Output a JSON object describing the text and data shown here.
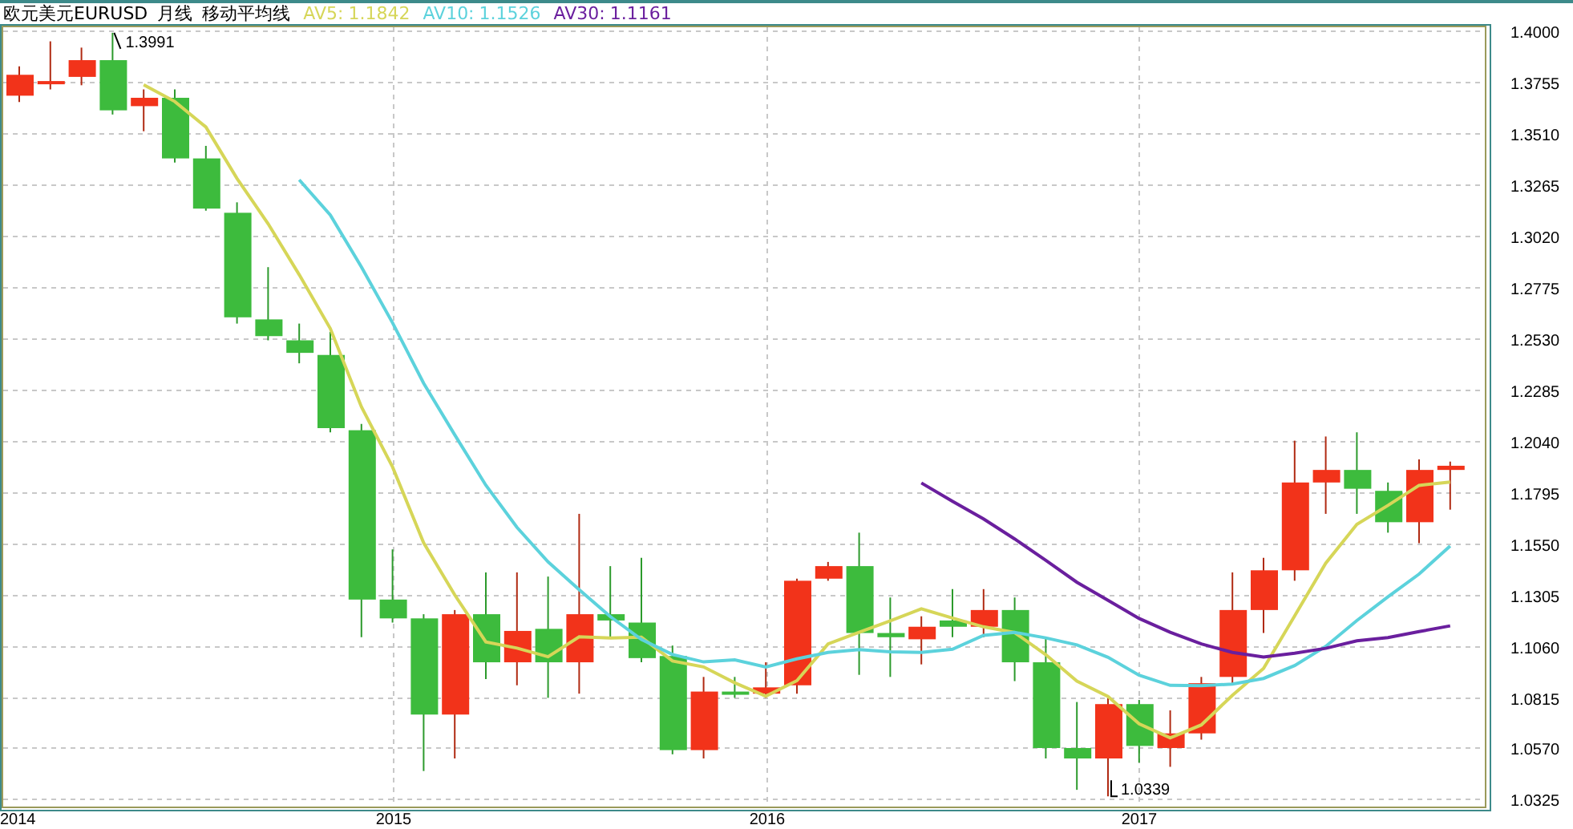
{
  "header": {
    "instrument": "欧元美元EURUSD",
    "period": "月线",
    "indicator": "移动平均线"
  },
  "chart": {
    "chart_data": {
      "type": "line",
      "grid": true,
      "categories": [
        "2014",
        null,
        null,
        null,
        null,
        null,
        null,
        null,
        null,
        null,
        null,
        null,
        "2015",
        null,
        null,
        null,
        null,
        null,
        null,
        null,
        null,
        null,
        null,
        null,
        "2016",
        null,
        null,
        null,
        null,
        null,
        null,
        null,
        null,
        null,
        null,
        null,
        "2017",
        null,
        null,
        null,
        null,
        null,
        null,
        null,
        null,
        null,
        null
      ],
      "ylim": [
        1.029,
        1.4025
      ],
      "yticks": [
        {
          "value": 1.4,
          "label": "1.4000"
        },
        {
          "value": 1.3755,
          "label": "1.3755"
        },
        {
          "value": 1.351,
          "label": "1.3510"
        },
        {
          "value": 1.3265,
          "label": "1.3265"
        },
        {
          "value": 1.302,
          "label": "1.3020"
        },
        {
          "value": 1.2775,
          "label": "1.2775"
        },
        {
          "value": 1.253,
          "label": "1.2530"
        },
        {
          "value": 1.2285,
          "label": "1.2285"
        },
        {
          "value": 1.204,
          "label": "1.2040"
        },
        {
          "value": 1.1795,
          "label": "1.1795"
        },
        {
          "value": 1.155,
          "label": "1.1550"
        },
        {
          "value": 1.1305,
          "label": "1.1305"
        },
        {
          "value": 1.106,
          "label": "1.1060"
        },
        {
          "value": 1.0815,
          "label": "1.0815"
        },
        {
          "value": 1.057,
          "label": "1.0570"
        },
        {
          "value": 1.0325,
          "label": "1.0325"
        }
      ],
      "series": [
        {
          "color": "#d6d658",
          "values": [
            null,
            null,
            null,
            null,
            1.3742,
            1.3662,
            1.354,
            1.3294,
            1.3078,
            1.2834,
            1.2576,
            1.2202,
            1.1914,
            1.1552,
            1.1302,
            1.1078,
            1.1048,
            1.1006,
            1.1102,
            1.1096,
            1.11,
            1.0986,
            1.0958,
            1.0882,
            1.0818,
            1.0892,
            1.1068,
            1.1124,
            1.1178,
            1.1236,
            1.1192,
            1.115,
            1.1122,
            1.1016,
            1.089,
            1.0816,
            1.0686,
            1.0618,
            1.068,
            1.0822,
            1.095,
            1.1202,
            1.1454,
            1.164,
            1.173,
            1.1826,
            1.1842
          ]
        },
        {
          "color": "#5cd2dc",
          "values": [
            null,
            null,
            null,
            null,
            null,
            null,
            null,
            null,
            null,
            1.3288,
            1.3119,
            1.2871,
            1.2604,
            1.2315,
            1.2068,
            1.1827,
            1.1625,
            1.146,
            1.1327,
            1.1199,
            1.1089,
            1.1017,
            1.0982,
            1.0992,
            1.0957,
            1.0996,
            1.1027,
            1.1041,
            1.103,
            1.1027,
            1.1042,
            1.1109,
            1.1123,
            1.1097,
            1.1063,
            1.1004,
            1.0918,
            1.087,
            1.0868,
            1.0876,
            1.0903,
            1.0964,
            1.1056,
            1.118,
            1.1293,
            1.1402,
            1.1536
          ]
        },
        {
          "color": "#6a1f9e",
          "values": [
            null,
            null,
            null,
            null,
            null,
            null,
            null,
            null,
            null,
            null,
            null,
            null,
            null,
            null,
            null,
            null,
            null,
            null,
            null,
            null,
            null,
            null,
            null,
            null,
            null,
            null,
            null,
            null,
            null,
            1.1838,
            1.175,
            1.1666,
            1.157,
            1.1468,
            1.1363,
            1.1276,
            1.119,
            1.1124,
            1.1068,
            1.1027,
            1.1005,
            1.1023,
            1.1047,
            1.1083,
            1.1098,
            1.1127,
            1.1154
          ]
        }
      ]
    },
    "price_labels": [
      {
        "text": "1.3991"
      },
      {
        "text": "1.0339"
      }
    ],
    "moving_averages": [
      {
        "label": "AV5:",
        "reading": "1.1842",
        "color": "#d6d658"
      },
      {
        "label": "AV10:",
        "reading": "1.1526",
        "color": "#5cd2dc"
      },
      {
        "label": "AV30:",
        "reading": "1.1161",
        "color": "#6a1f9e"
      }
    ]
  }
}
